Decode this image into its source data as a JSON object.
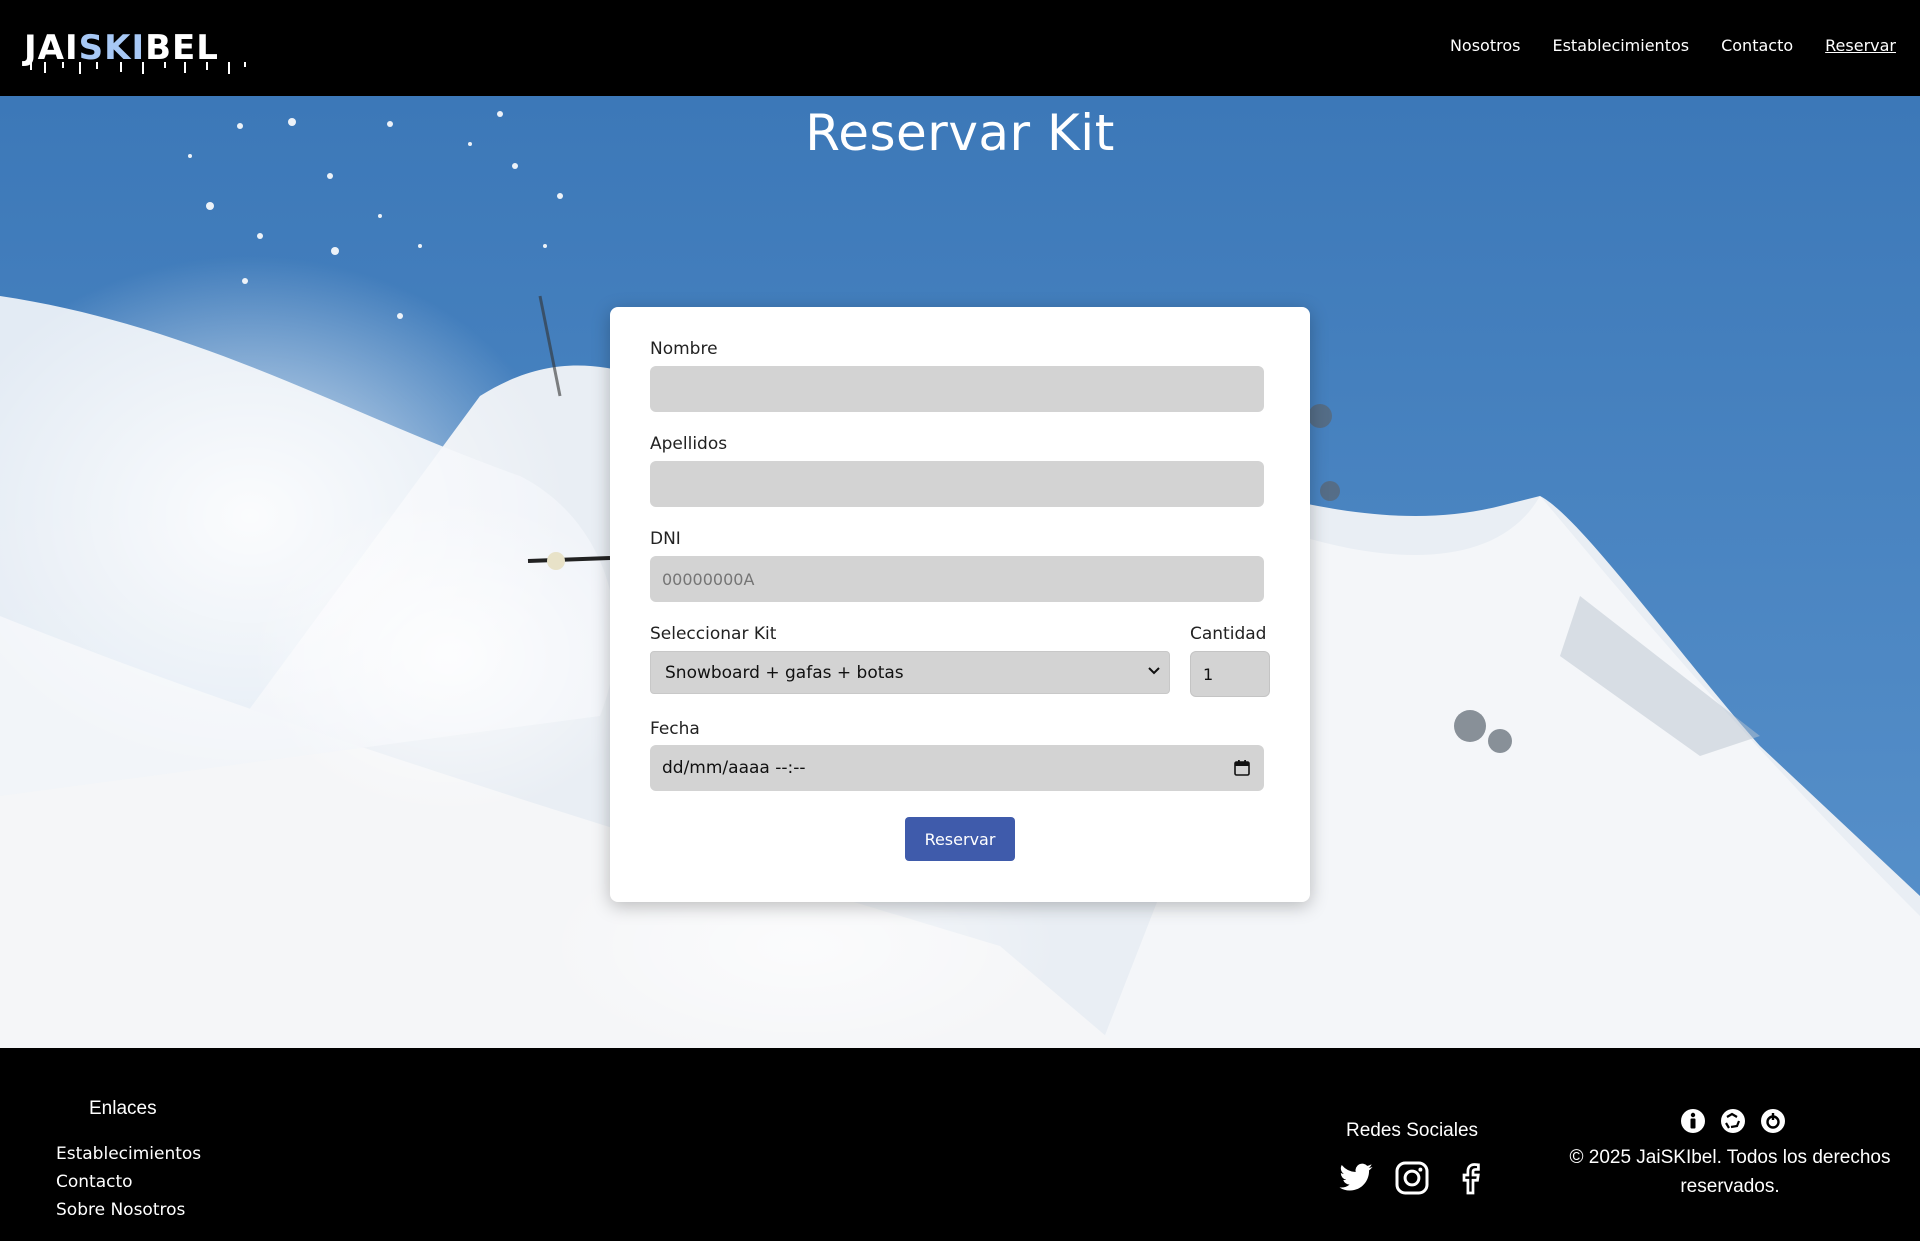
{
  "header": {
    "logo_parts": [
      "JAI",
      "SKI",
      "BEL"
    ],
    "nav": [
      {
        "label": "Nosotros",
        "active": false
      },
      {
        "label": "Establecimientos",
        "active": false
      },
      {
        "label": "Contacto",
        "active": false
      },
      {
        "label": "Reservar",
        "active": true
      }
    ]
  },
  "page": {
    "title": "Reservar Kit"
  },
  "form": {
    "nombre": {
      "label": "Nombre",
      "value": "",
      "placeholder": ""
    },
    "apellidos": {
      "label": "Apellidos",
      "value": "",
      "placeholder": ""
    },
    "dni": {
      "label": "DNI",
      "value": "",
      "placeholder": "00000000A"
    },
    "kit": {
      "label": "Seleccionar Kit",
      "selected": "Snowboard + gafas + botas"
    },
    "cantidad": {
      "label": "Cantidad",
      "value": "1"
    },
    "fecha": {
      "label": "Fecha",
      "placeholder": "dd/mm/aaaa --:--"
    },
    "submit_label": "Reservar"
  },
  "footer": {
    "links_title": "Enlaces",
    "links": [
      "Establecimientos",
      "Contacto",
      "Sobre Nosotros"
    ],
    "social_title": "Redes Sociales",
    "social": [
      "twitter-icon",
      "instagram-icon",
      "facebook-icon"
    ],
    "mini_icons": [
      "info-icon",
      "recycle-icon",
      "power-icon"
    ],
    "copyright_line1": "© 2025 JaiSKIbel. Todos los derechos",
    "copyright_line2": "reservados."
  },
  "colors": {
    "header_bg": "#000000",
    "button_bg": "#3f5bab",
    "input_bg": "#d3d3d3",
    "logo_accent": "#a7c8f5"
  }
}
